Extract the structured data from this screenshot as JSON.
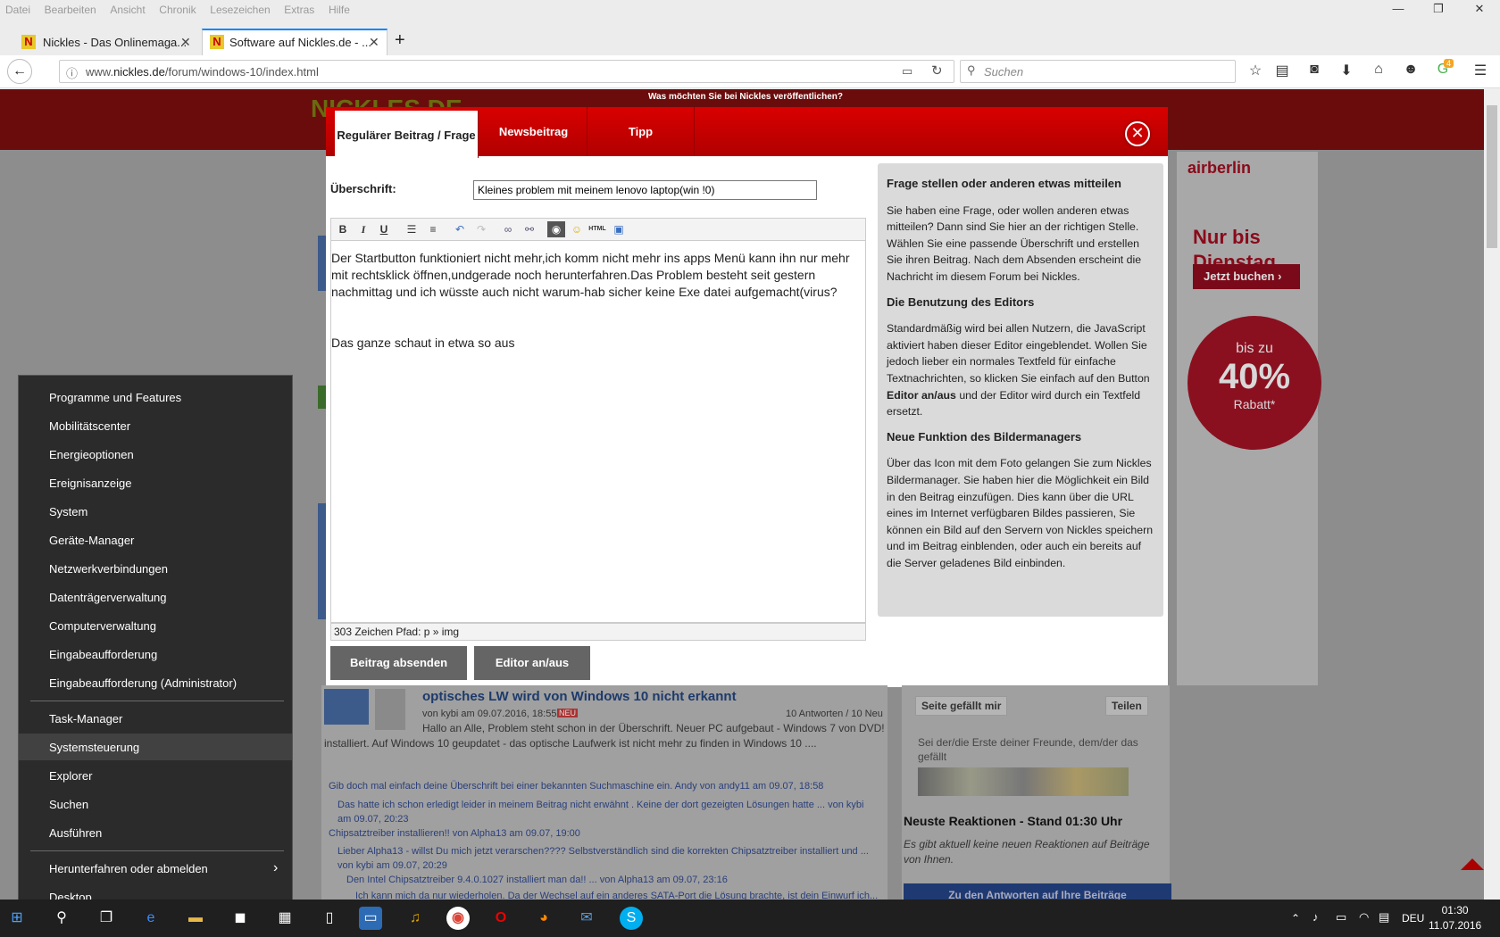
{
  "browser": {
    "menu": [
      "Datei",
      "Bearbeiten",
      "Ansicht",
      "Chronik",
      "Lesezeichen",
      "Extras",
      "Hilfe"
    ],
    "tabs": [
      {
        "title": "Nickles - Das Onlinemaga..."
      },
      {
        "title": "Software auf Nickles.de - ..."
      }
    ],
    "url": "www.nickles.de/forum/windows-10/index.html",
    "url_domain": "nickles.de",
    "search_placeholder": "Suchen",
    "badge": "4"
  },
  "page": {
    "publish_question": "Was möchten Sie bei Nickles veröffentlichen?",
    "logo": "NICKLES.DE"
  },
  "modal": {
    "tabs": [
      "Regulärer Beitrag / Frage",
      "Newsbeitrag",
      "Tipp"
    ],
    "heading_label": "Überschrift:",
    "heading_value": "Kleines problem mit meinem lenovo laptop(win !0)",
    "body_p1": "Der Startbutton funktioniert nicht mehr,ich komm nicht mehr ins apps Menü kann ihn nur mehr mit rechtsklick öffnen,undgerade noch herunterfahren.Das Problem besteht seit gestern nachmittag und ich wüsste auch nicht warum-hab sicher keine Exe datei aufgemacht(virus?",
    "body_p2": "Das ganze schaut in etwa so aus",
    "status": "303 Zeichen Pfad: p » img",
    "submit": "Beitrag absenden",
    "toggle": "Editor an/aus",
    "help": {
      "h1": "Frage stellen oder anderen etwas mitteilen",
      "p1": "Sie haben eine Frage, oder wollen anderen etwas mitteilen? Dann sind Sie hier an der richtigen Stelle. Wählen Sie eine passende Überschrift und erstellen Sie ihren Beitrag. Nach dem Absenden erscheint die Nachricht im diesem Forum bei Nickles.",
      "h2": "Die Benutzung des Editors",
      "p2a": "Standardmäßig wird bei allen Nutzern, die JavaScript aktiviert haben dieser Editor eingeblendet. Wollen Sie jedoch lieber ein normales Textfeld für einfache Textnachrichten, so klicken Sie einfach auf den Button ",
      "p2b": "Editor an/aus",
      "p2c": " und der Editor wird durch ein Textfeld ersetzt.",
      "h3": "Neue Funktion des Bildermanagers",
      "p3": "Über das Icon mit dem Foto gelangen Sie zum Nickles Bildermanager. Sie haben hier die Möglichkeit ein Bild in den Beitrag einzufügen. Dies kann über die URL eines im Internet verfügbaren Bildes passieren, Sie können ein Bild auf den Servern von Nickles speichern und im Beitrag einblenden, oder auch ein bereits auf die Server geladenes Bild einbinden."
    }
  },
  "ad": {
    "brand": "airberlin",
    "headline1": "Nur bis",
    "headline2": "Dienstag.",
    "cta": "Jetzt buchen ›",
    "pre": "bis zu",
    "percent": "40%",
    "rabatt": "Rabatt*"
  },
  "context_menu": {
    "items": [
      "Programme und Features",
      "Mobilitätscenter",
      "Energieoptionen",
      "Ereignisanzeige",
      "System",
      "Geräte-Manager",
      "Netzwerkverbindungen",
      "Datenträgerverwaltung",
      "Computerverwaltung",
      "Eingabeaufforderung",
      "Eingabeaufforderung (Administrator)",
      "Task-Manager",
      "Systemsteuerung",
      "Explorer",
      "Suchen",
      "Ausführen",
      "Herunterfahren oder abmelden",
      "Desktop"
    ]
  },
  "forum": {
    "post_title": "optisches LW wird von Windows 10 nicht erkannt",
    "post_meta": "von kybi am 09.07.2016, 18:55",
    "new": "NEU",
    "replies": "10 Antworten / 10 Neu",
    "post_body": "Hallo an Alle, Problem steht schon in der Überschrift. Neuer PC aufgebaut - Windows 7 von DVD! installiert. Auf Windows 10 geupdatet - das optische Laufwerk ist nicht mehr zu finden in Windows 10 ....",
    "r1": "Gib doch mal einfach deine Überschrift bei einer bekannten Suchmaschine ein. Andy von andy11 am 09.07, 18:58",
    "r2": "Das hatte ich schon erledigt leider in meinem Beitrag nicht erwähnt . Keine der dort gezeigten Lösungen hatte ... von kybi am 09.07, 20:23",
    "r3": "Chipsatztreiber installieren!! von Alpha13 am 09.07, 19:00",
    "r4": "Lieber Alpha13 - willst Du mich jetzt verarschen???? Selbstverständlich sind die korrekten Chipsatztreiber installiert und ... von kybi am 09.07, 20:29",
    "r5": "Den Intel Chipsatztreiber 9.4.0.1027 installiert man da!! ... von Alpha13 am 09.07, 23:16",
    "r6": "Ich kann mich da nur wiederholen. Da der Wechsel auf ein anderes SATA-Port die Lösung brachte, ist dein Einwurf ich..."
  },
  "sidebar": {
    "like": "Seite gefällt mir",
    "share": "Teilen",
    "friends": "Sei der/die Erste deiner Freunde, dem/der das gefällt",
    "reactions_title": "Neuste Reaktionen - Stand 01:30 Uhr",
    "reactions_empty": "Es gibt aktuell keine neuen Reaktionen auf Beiträge von Ihnen.",
    "answers_btn": "Zu den Antworten auf Ihre Beiträge"
  },
  "taskbar": {
    "lang": "DEU",
    "time": "01:30",
    "date": "11.07.2016"
  }
}
